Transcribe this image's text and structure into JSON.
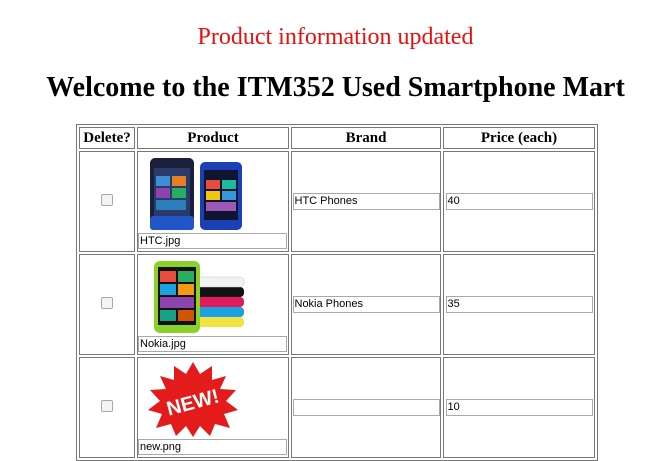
{
  "status_message": "Product information updated",
  "page_title": "Welcome to the ITM352 Used Smartphone Mart",
  "table": {
    "headers": {
      "delete": "Delete?",
      "product": "Product",
      "brand": "Brand",
      "price": "Price (each)"
    },
    "rows": [
      {
        "filename": "HTC.jpg",
        "brand": "HTC Phones",
        "price": "40",
        "image": "htc-phone-image"
      },
      {
        "filename": "Nokia.jpg",
        "brand": "Nokia Phones",
        "price": "35",
        "image": "nokia-phone-image"
      },
      {
        "filename": "new.png",
        "brand": "",
        "price": "10",
        "image": "new-badge-image"
      }
    ]
  },
  "colors": {
    "status": "#e8100c",
    "badge": "#e31b1b"
  },
  "new_badge_text": "NEW!"
}
